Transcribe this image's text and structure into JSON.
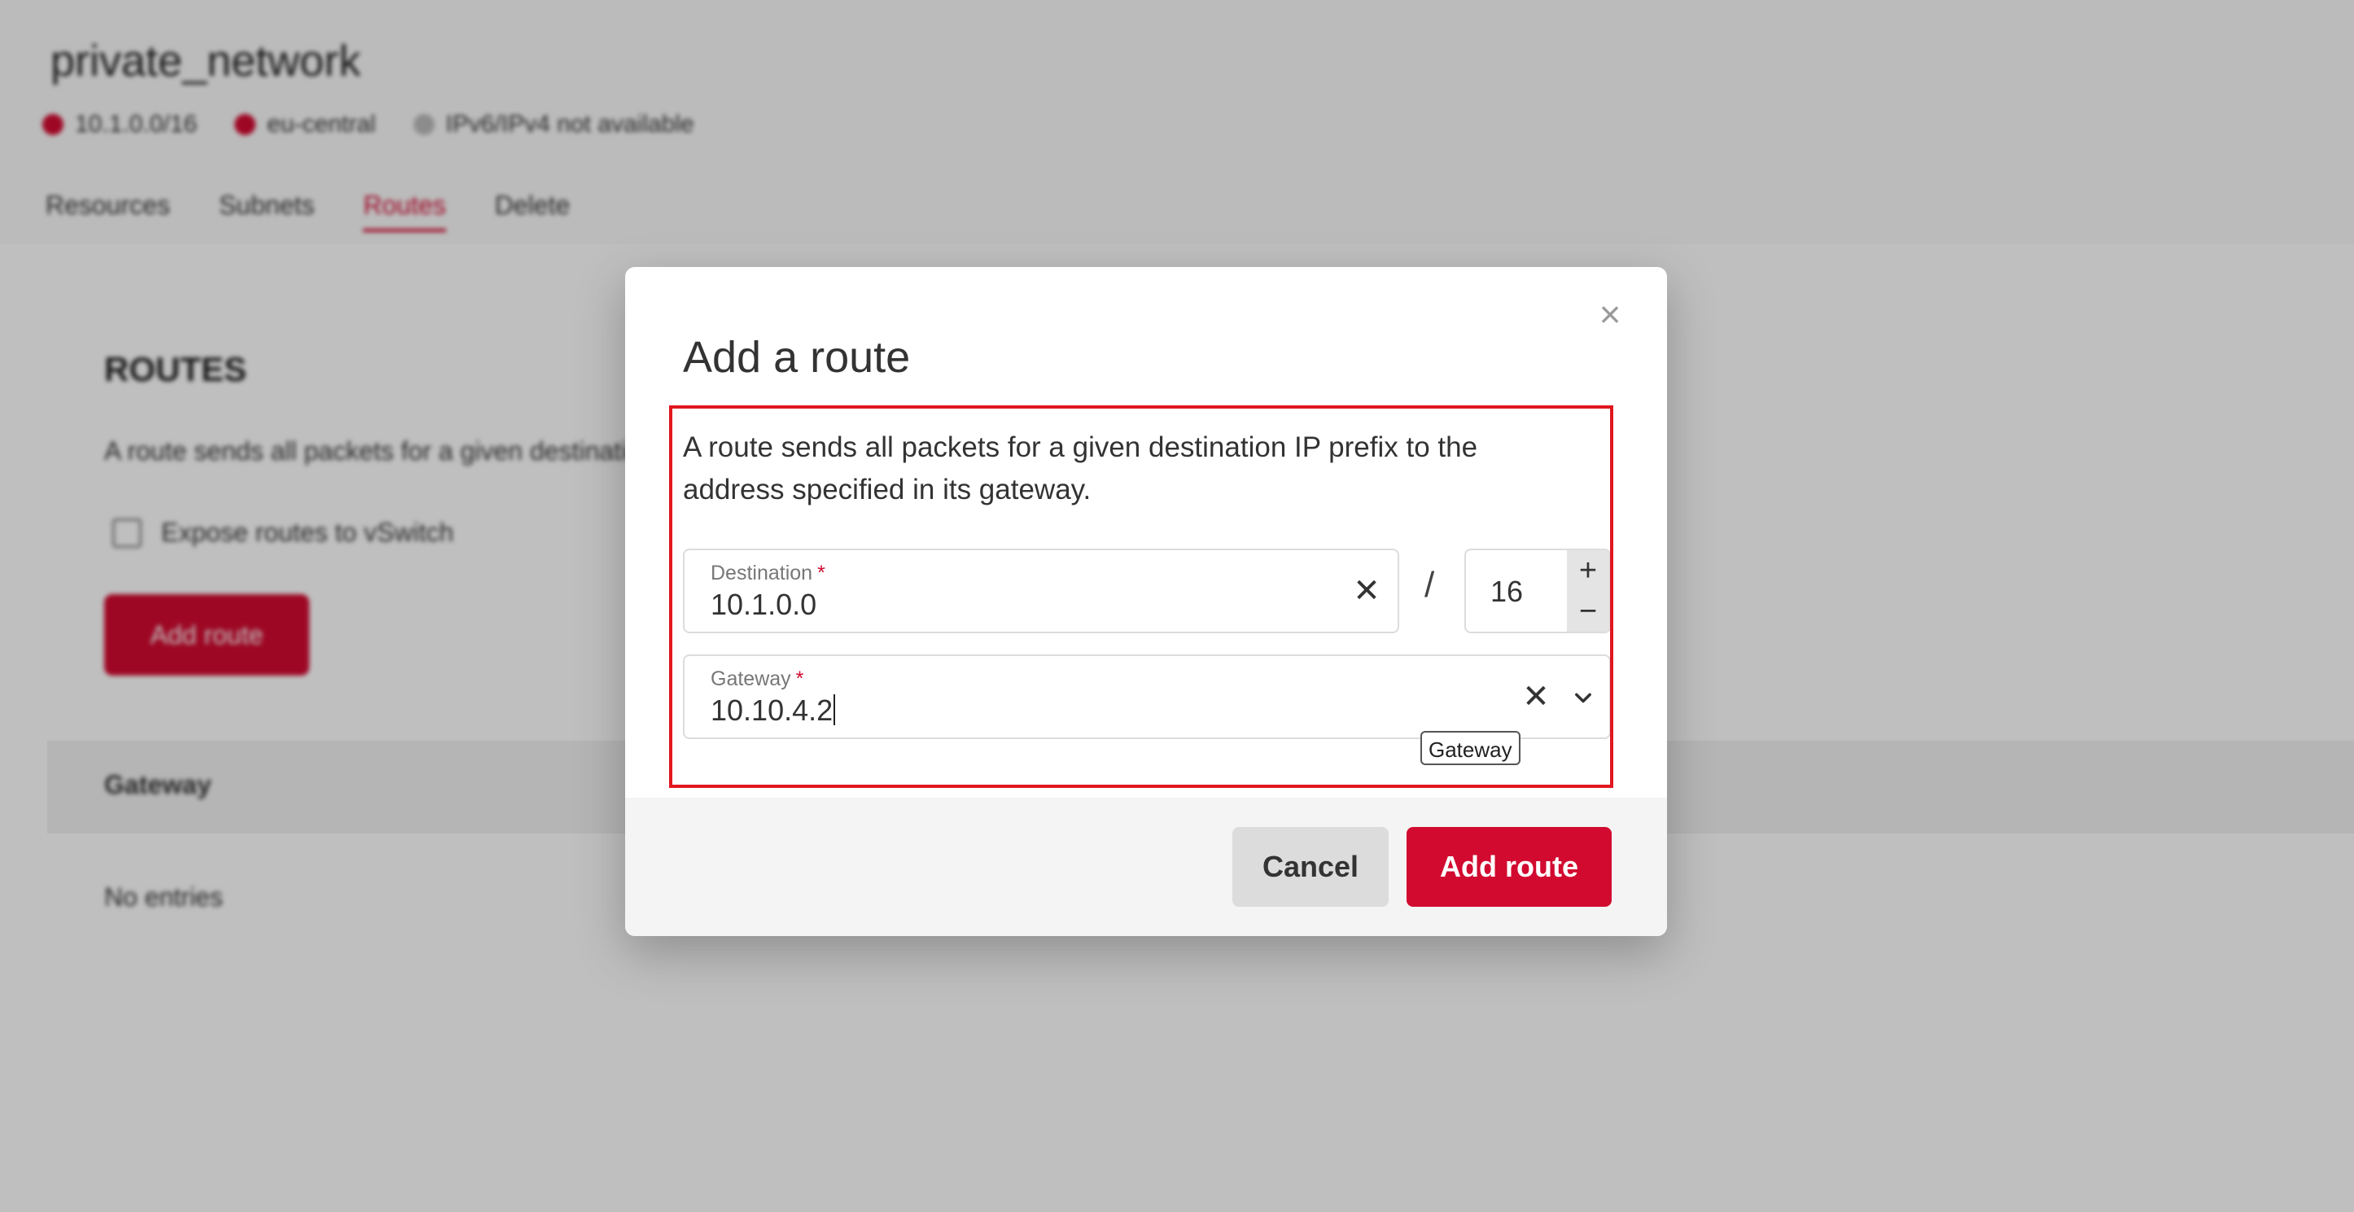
{
  "background": {
    "page_title": "private_network",
    "meta": [
      "10.1.0.0/16",
      "eu-central",
      "IPv6/IPv4 not available"
    ],
    "tabs": [
      "Resources",
      "Subnets",
      "Routes",
      "Delete"
    ],
    "active_tab": "Routes",
    "card_title": "ROUTES",
    "card_desc": "A route sends all packets for a given destination IP prefix to the address specified in its gateway.",
    "checkbox_label": "Expose routes to vSwitch",
    "add_button": "Add route",
    "table_header": "Gateway",
    "table_row": "No entries"
  },
  "modal": {
    "title": "Add a route",
    "close_icon": "close-icon",
    "description": "A route sends all packets for a given destination IP prefix to the address specified in its gateway.",
    "destination": {
      "label": "Destination",
      "required_mark": "*",
      "value": "10.1.0.0"
    },
    "slash": "/",
    "prefix": {
      "value": "16",
      "plus": "+",
      "minus": "−"
    },
    "gateway": {
      "label": "Gateway",
      "required_mark": "*",
      "value": "10.10.4.2"
    },
    "tooltip": "Gateway",
    "cancel_label": "Cancel",
    "submit_label": "Add route"
  },
  "colors": {
    "accent": "#d20a30",
    "highlight_border": "#e1171f"
  }
}
